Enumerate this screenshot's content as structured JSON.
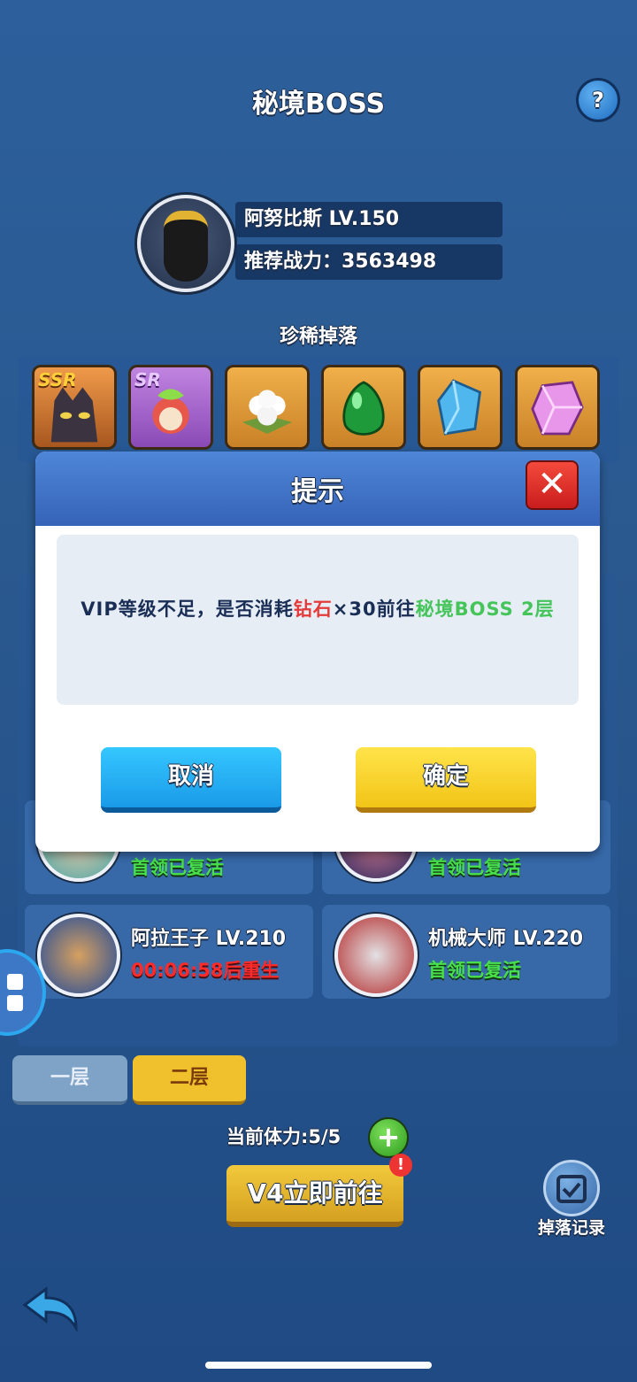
{
  "header": {
    "title": "秘境BOSS",
    "help_label": "?"
  },
  "boss": {
    "name_level": "阿努比斯   LV.150",
    "power": "推荐战力：3563498"
  },
  "drops": {
    "label": "珍稀掉落",
    "items": [
      {
        "rarity": "SSR",
        "icon": "dark-cat-hero-icon"
      },
      {
        "rarity": "SR",
        "icon": "leaf-sprite-hero-icon"
      },
      {
        "rarity": "",
        "icon": "cotton-flower-icon"
      },
      {
        "rarity": "",
        "icon": "green-gem-icon"
      },
      {
        "rarity": "",
        "icon": "blue-crystal-icon"
      },
      {
        "rarity": "",
        "icon": "pink-crystal-icon"
      }
    ]
  },
  "bosses": [
    {
      "name": "",
      "status": "首领已复活"
    },
    {
      "name": "",
      "status": "首领已复活"
    },
    {
      "name": "阿拉王子 LV.210",
      "status": "00:06:58后重生"
    },
    {
      "name": "机械大师 LV.220",
      "status": "首领已复活"
    }
  ],
  "floors": {
    "first": "一层",
    "second": "二层"
  },
  "stamina": {
    "text": "当前体力:5/5"
  },
  "go_button": {
    "label": "V4立即前往",
    "badge": "!"
  },
  "drop_log": {
    "label": "掉落记录"
  },
  "dialog": {
    "title": "提示",
    "close": "✕",
    "message_parts": {
      "prefix": "VIP等级不足，是否消耗",
      "cost_item": "钻石",
      "cost_amount": "×30前往",
      "target": "秘境BOSS 2层"
    },
    "cancel": "取消",
    "confirm": "确定"
  },
  "colors": {
    "background": "#2a598f",
    "dialog_header": "#3e72c8",
    "cancel": "#1fa8f0",
    "confirm": "#f7d22a"
  }
}
